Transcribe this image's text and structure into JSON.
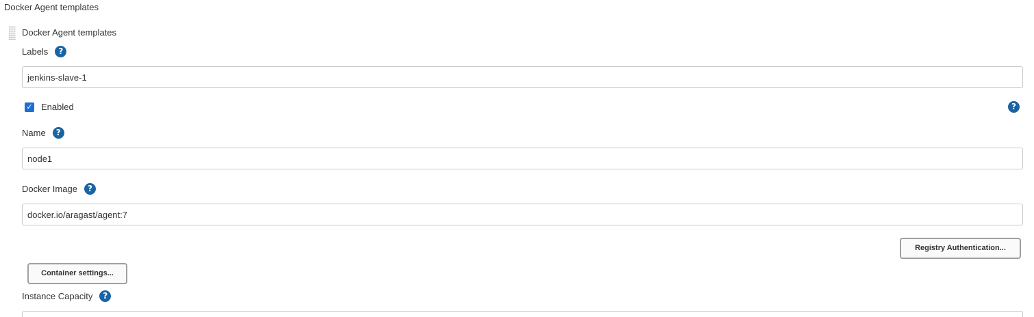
{
  "section": {
    "title": "Docker Agent templates",
    "subsection_title": "Docker Agent templates"
  },
  "fields": {
    "labels": {
      "label": "Labels",
      "value": "jenkins-slave-1"
    },
    "enabled": {
      "label": "Enabled",
      "checked": true
    },
    "name": {
      "label": "Name",
      "value": "node1"
    },
    "docker_image": {
      "label": "Docker Image",
      "value": "docker.io/aragast/agent:7"
    },
    "instance_capacity": {
      "label": "Instance Capacity",
      "value": ""
    }
  },
  "buttons": {
    "registry_auth": "Registry Authentication...",
    "container_settings": "Container settings..."
  },
  "icons": {
    "help_glyph": "?",
    "check_glyph": "✓"
  },
  "colors": {
    "help_icon": "#1a64a3",
    "checkbox": "#1f6fd1"
  }
}
